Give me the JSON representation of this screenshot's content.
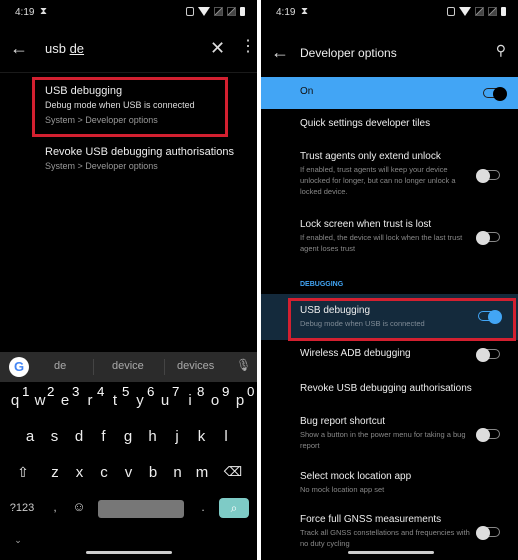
{
  "left": {
    "status": {
      "time": "4:19"
    },
    "search": {
      "query_prefix": "usb ",
      "query_composing": "de"
    },
    "results": [
      {
        "title": "USB debugging",
        "subtitle": "Debug mode when USB is connected",
        "path": "System > Developer options",
        "highlighted": true
      },
      {
        "title": "Revoke USB debugging authorisations",
        "path": "System > Developer options"
      }
    ],
    "keyboard": {
      "suggestions": [
        "de",
        "device",
        "devices"
      ],
      "row1": [
        "q",
        "w",
        "e",
        "r",
        "t",
        "y",
        "u",
        "i",
        "o",
        "p"
      ],
      "row1_hints": [
        "1",
        "2",
        "3",
        "4",
        "5",
        "6",
        "7",
        "8",
        "9",
        "0"
      ],
      "row2": [
        "a",
        "s",
        "d",
        "f",
        "g",
        "h",
        "j",
        "k",
        "l"
      ],
      "row3": [
        "z",
        "x",
        "c",
        "v",
        "b",
        "n",
        "m"
      ],
      "symbols_label": "?123",
      "comma": ",",
      "period": ".",
      "google_label": "G"
    }
  },
  "right": {
    "status": {
      "time": "4:19"
    },
    "title": "Developer options",
    "master": {
      "label": "On",
      "enabled": true
    },
    "prefs": [
      {
        "title": "Quick settings developer tiles"
      },
      {
        "title": "Trust agents only extend unlock",
        "desc": "If enabled, trust agents will keep your device unlocked for longer, but can no longer unlock a locked device.",
        "enabled": false
      },
      {
        "title": "Lock screen when trust is lost",
        "desc": "If enabled, the device will lock when the last trust agent loses trust",
        "enabled": false
      }
    ],
    "category": "DEBUGGING",
    "debug_prefs": [
      {
        "title": "USB debugging",
        "desc": "Debug mode when USB is connected",
        "enabled": true,
        "highlighted": true
      },
      {
        "title": "Wireless ADB debugging",
        "enabled": false
      },
      {
        "title": "Revoke USB debugging authorisations"
      },
      {
        "title": "Bug report shortcut",
        "desc": "Show a button in the power menu for taking a bug report",
        "enabled": false
      },
      {
        "title": "Select mock location app",
        "desc": "No mock location app set"
      },
      {
        "title": "Force full GNSS measurements",
        "desc": "Track all GNSS constellations and frequencies with no duty cycling",
        "enabled": false
      }
    ]
  },
  "colors": {
    "accent": "#42a5f5",
    "highlight_border": "#d32030",
    "search_key": "#7ecbc6"
  }
}
